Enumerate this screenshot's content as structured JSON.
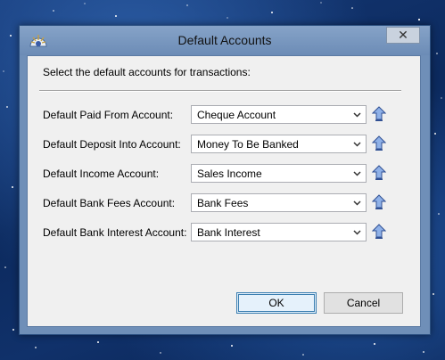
{
  "window": {
    "title": "Default Accounts",
    "close_label": "✕"
  },
  "dialog": {
    "instructions": "Select the default accounts for transactions:",
    "fields": [
      {
        "label": "Default Paid From Account:",
        "value": "Cheque Account"
      },
      {
        "label": "Default Deposit Into Account:",
        "value": "Money To Be Banked"
      },
      {
        "label": "Default Income Account:",
        "value": "Sales Income"
      },
      {
        "label": "Default Bank Fees Account:",
        "value": "Bank Fees"
      },
      {
        "label": "Default Bank Interest Account:",
        "value": "Bank Interest"
      }
    ],
    "ok_label": "OK",
    "cancel_label": "Cancel"
  },
  "icons": {
    "app": "app-logo-icon",
    "dropdown": "chevron-down-icon",
    "drill": "up-arrow-icon",
    "close": "close-icon"
  },
  "colors": {
    "titlebar": "#7895bd",
    "client_background": "#f0f0f0",
    "default_button_border": "#3c7fb1",
    "drill_icon": "#3a5ca8"
  }
}
